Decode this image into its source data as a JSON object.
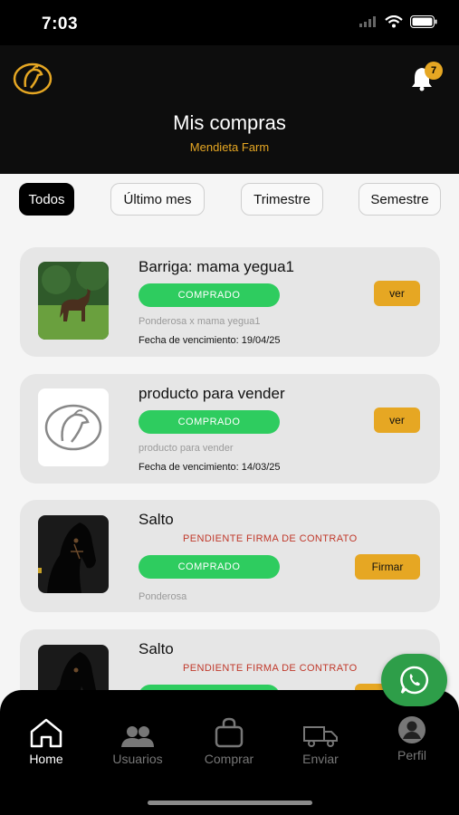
{
  "status_bar": {
    "time": "7:03"
  },
  "header": {
    "logo_icon": "horse-head-logo-icon",
    "title": "Mis compras",
    "subtitle": "Mendieta Farm",
    "notifications_count": "7"
  },
  "filters": [
    {
      "label": "Todos",
      "active": true
    },
    {
      "label": "Último mes",
      "active": false
    },
    {
      "label": "Trimestre",
      "active": false
    },
    {
      "label": "Semestre",
      "active": false
    }
  ],
  "purchases": [
    {
      "title": "Barriga: mama yegua1",
      "status": "COMPRADO",
      "description": "Ponderosa x mama yegua1",
      "due_date": "Fecha de vencimiento: 19/04/25",
      "action": "ver",
      "image": "horse-photo"
    },
    {
      "title": "producto para vender",
      "status": "COMPRADO",
      "description": "producto para vender",
      "due_date": "Fecha de vencimiento: 14/03/25",
      "action": "ver",
      "image": "horse-logo"
    },
    {
      "title": "Salto",
      "pending": "PENDIENTE FIRMA DE CONTRATO",
      "status": "COMPRADO",
      "description": "Ponderosa",
      "action": "Firmar",
      "image": "black-horse-photo"
    },
    {
      "title": "Salto",
      "pending": "PENDIENTE FIRMA DE CONTRATO",
      "image": "black-horse-photo"
    }
  ],
  "tabs": [
    {
      "label": "Home",
      "icon": "home-icon",
      "active": true
    },
    {
      "label": "Usuarios",
      "icon": "users-icon",
      "active": false
    },
    {
      "label": "Comprar",
      "icon": "shopping-bag-icon",
      "active": false
    },
    {
      "label": "Enviar",
      "icon": "truck-icon",
      "active": false
    },
    {
      "label": "Perfil",
      "icon": "user-avatar-icon",
      "active": false
    }
  ],
  "colors": {
    "accent": "#e6a723",
    "success": "#2ecc5f",
    "danger": "#c0392b",
    "whatsapp": "#2e9e49"
  }
}
